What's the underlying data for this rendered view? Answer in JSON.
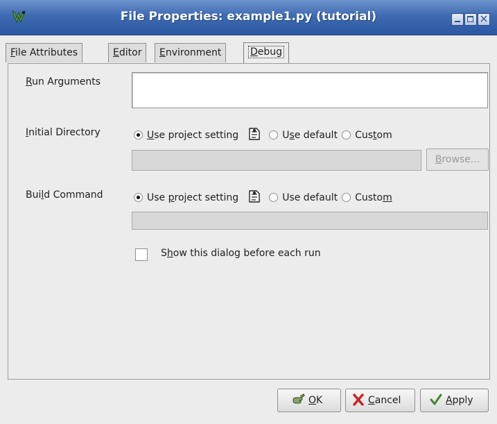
{
  "window": {
    "title": "File Properties: example1.py (tutorial)"
  },
  "tabs": [
    {
      "label": "File Attributes",
      "mnemonic": "F",
      "active": false
    },
    {
      "label": "Editor",
      "mnemonic": "E",
      "active": false
    },
    {
      "label": "Environment",
      "mnemonic": "E",
      "active": false
    },
    {
      "label": "Debug",
      "mnemonic": "D",
      "active": true
    }
  ],
  "form": {
    "run_arguments": {
      "label": "Run Arguments",
      "value": ""
    },
    "initial_directory": {
      "label": "Initial Directory",
      "options": [
        "Use project setting",
        "Use default",
        "Custom"
      ],
      "selected": "Use project setting",
      "path_value": "",
      "browse_label": "Browse..."
    },
    "build_command": {
      "label": "Build Command",
      "options": [
        "Use project setting",
        "Use default",
        "Custom"
      ],
      "selected": "Use project setting",
      "command_value": ""
    },
    "show_dialog": {
      "label": "Show this dialog before each run",
      "checked": false
    }
  },
  "buttons": {
    "ok": "OK",
    "cancel": "Cancel",
    "apply": "Apply"
  },
  "icons": {
    "app": "wing-ide-icon",
    "project_setting": "project-setting-icon",
    "ok": "ok-hand-icon",
    "cancel": "red-x-icon",
    "apply": "green-check-icon"
  },
  "colors": {
    "titlebar": "#3f6bb2",
    "window_bg": "#ececec",
    "cancel_icon": "#cc2020",
    "apply_icon": "#3c8a2a"
  }
}
